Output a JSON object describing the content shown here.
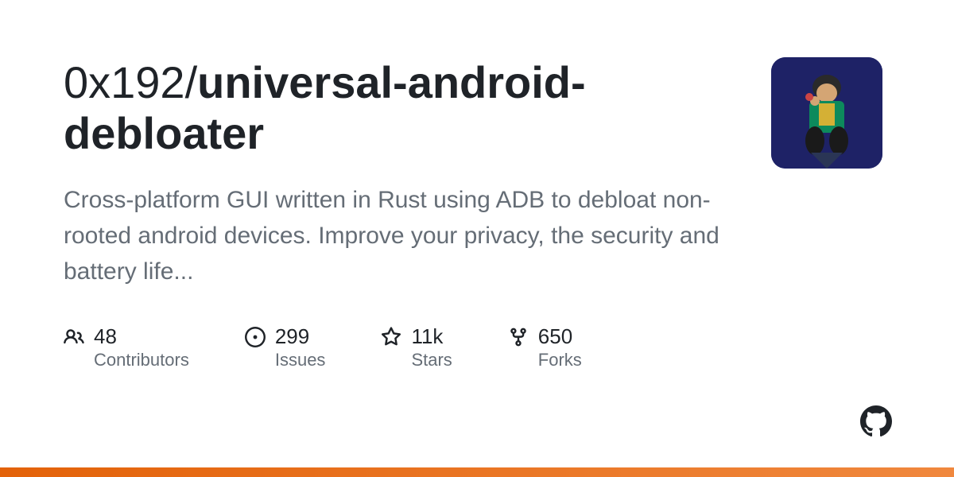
{
  "repo": {
    "owner": "0x192",
    "name": "universal-android-debloater",
    "description": "Cross-platform GUI written in Rust using ADB to debloat non-rooted android devices. Improve your privacy, the security and battery life..."
  },
  "stats": {
    "contributors": {
      "value": "48",
      "label": "Contributors"
    },
    "issues": {
      "value": "299",
      "label": "Issues"
    },
    "stars": {
      "value": "11k",
      "label": "Stars"
    },
    "forks": {
      "value": "650",
      "label": "Forks"
    }
  }
}
